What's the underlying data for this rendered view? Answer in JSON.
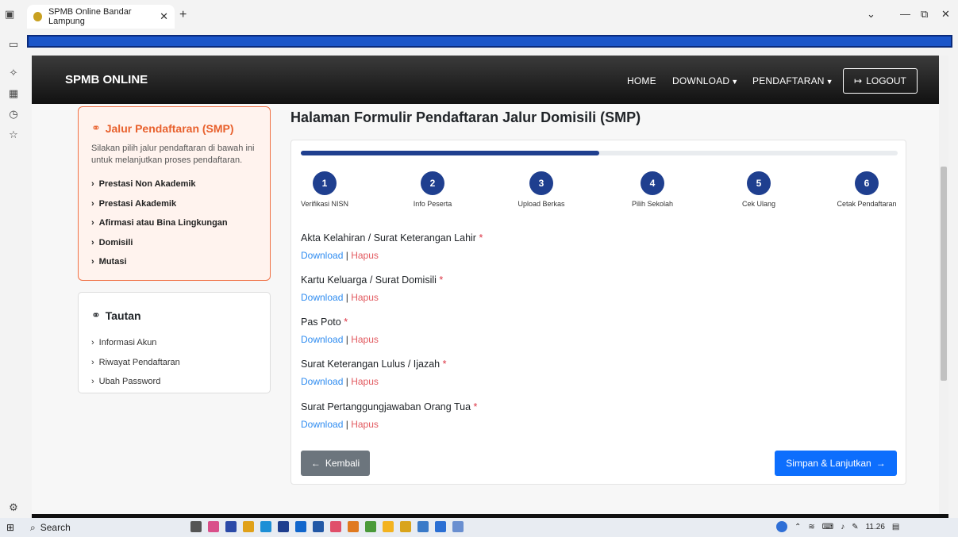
{
  "browser": {
    "tab_title": "SPMB Online Bandar Lampung",
    "tab_close": "✕",
    "new_tab": "+",
    "window_controls": [
      "⌄",
      "—",
      "⧉",
      "✕"
    ]
  },
  "site": {
    "brand": "SPMB ONLINE",
    "nav": {
      "home": "HOME",
      "download": "DOWNLOAD",
      "pendaftaran": "PENDAFTARAN",
      "logout": "LOGOUT"
    }
  },
  "jalur": {
    "title": "Jalur Pendaftaran (SMP)",
    "description": "Silakan pilih jalur pendaftaran di bawah ini untuk melanjutkan proses pendaftaran.",
    "items": [
      "Prestasi Non Akademik",
      "Prestasi Akademik",
      "Afirmasi atau Bina Lingkungan",
      "Domisili",
      "Mutasi"
    ]
  },
  "tautan": {
    "title": "Tautan",
    "items": [
      "Informasi Akun",
      "Riwayat Pendaftaran",
      "Ubah Password"
    ]
  },
  "page_title": "Halaman Formulir Pendaftaran Jalur Domisili (SMP)",
  "progress_fraction": 0.5,
  "steps": [
    {
      "num": "1",
      "label": "Verifikasi NISN"
    },
    {
      "num": "2",
      "label": "Info Peserta"
    },
    {
      "num": "3",
      "label": "Upload Berkas"
    },
    {
      "num": "4",
      "label": "Pilih Sekolah"
    },
    {
      "num": "5",
      "label": "Cek Ulang"
    },
    {
      "num": "6",
      "label": "Cetak Pendaftaran"
    }
  ],
  "documents": [
    {
      "label": "Akta Kelahiran / Surat Keterangan Lahir"
    },
    {
      "label": "Kartu Keluarga / Surat Domisili"
    },
    {
      "label": "Pas Poto"
    },
    {
      "label": "Surat Keterangan Lulus / Ijazah"
    },
    {
      "label": "Surat Pertanggungjawaban Orang Tua"
    }
  ],
  "doc_links": {
    "download": "Download",
    "separator": "|",
    "hapus": "Hapus",
    "required": "*"
  },
  "buttons": {
    "back": "Kembali",
    "next": "Simpan & Lanjutkan"
  },
  "taskbar": {
    "search": "Search",
    "time": "11.26"
  },
  "colors": {
    "accent_orange": "#e8602c",
    "primary_blue": "#0d6efd",
    "step_blue": "#1f3f8f"
  }
}
